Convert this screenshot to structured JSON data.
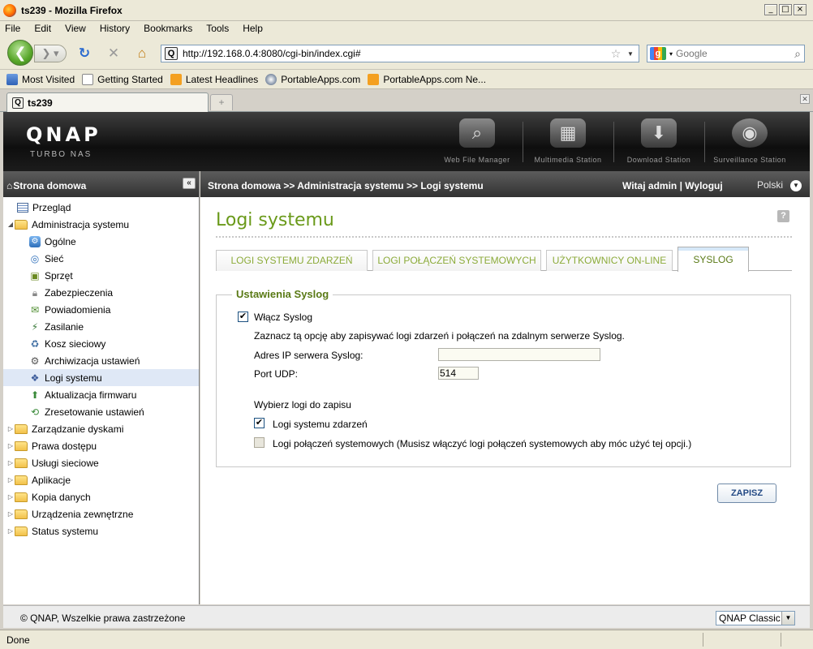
{
  "window": {
    "title": "ts239 - Mozilla Firefox",
    "controls": [
      "_",
      "□",
      "×"
    ]
  },
  "menu": [
    "File",
    "Edit",
    "View",
    "History",
    "Bookmarks",
    "Tools",
    "Help"
  ],
  "nav": {
    "url": "http://192.168.0.4:8080/cgi-bin/index.cgi#",
    "search_placeholder": "Google"
  },
  "bookmarks": [
    "Most Visited",
    "Getting Started",
    "Latest Headlines",
    "PortableApps.com",
    "PortableApps.com Ne..."
  ],
  "browser_tab": {
    "label": "ts239"
  },
  "qnap": {
    "logo": "QNAP",
    "subtitle": "Turbo NAS",
    "stations": [
      "Web File Manager",
      "Multimedia Station",
      "Download Station",
      "Surveillance Station"
    ]
  },
  "sidebar": {
    "header": "Strona domowa",
    "items": [
      {
        "label": "Przegląd"
      },
      {
        "label": "Administracja systemu"
      },
      {
        "label": "Ogólne"
      },
      {
        "label": "Sieć"
      },
      {
        "label": "Sprzęt"
      },
      {
        "label": "Zabezpieczenia"
      },
      {
        "label": "Powiadomienia"
      },
      {
        "label": "Zasilanie"
      },
      {
        "label": "Kosz sieciowy"
      },
      {
        "label": "Archiwizacja ustawień"
      },
      {
        "label": "Logi systemu"
      },
      {
        "label": "Aktualizacja firmwaru"
      },
      {
        "label": "Zresetowanie ustawień"
      },
      {
        "label": "Zarządzanie dyskami"
      },
      {
        "label": "Prawa dostępu"
      },
      {
        "label": "Usługi sieciowe"
      },
      {
        "label": "Aplikacje"
      },
      {
        "label": "Kopia danych"
      },
      {
        "label": "Urządzenia zewnętrzne"
      },
      {
        "label": "Status systemu"
      }
    ]
  },
  "header": {
    "breadcrumb": "Strona domowa >> Administracja systemu >> Logi systemu",
    "welcome": "Witaj admin",
    "separator": "|",
    "logout": "Wyloguj",
    "language": "Polski"
  },
  "page": {
    "title": "Logi systemu",
    "tabs": [
      "LOGI SYSTEMU ZDARZEŃ",
      "LOGI POŁĄCZEŃ SYSTEMOWYCH",
      "UŻYTKOWNICY ON-LINE",
      "SYSLOG"
    ],
    "active_tab": "SYSLOG"
  },
  "syslog": {
    "legend": "Ustawienia Syslog",
    "enable_label": "Włącz Syslog",
    "enable_checked": true,
    "description": "Zaznacz tą opcję aby zapisywać logi zdarzeń i połączeń na zdalnym serwerze Syslog.",
    "ip_label": "Adres IP serwera Syslog:",
    "ip_value": "",
    "port_label": "Port UDP:",
    "port_value": "514",
    "logs_heading": "Wybierz logi do zapisu",
    "event_logs_label": "Logi systemu zdarzeń",
    "event_logs_checked": true,
    "conn_logs_label": "Logi połączeń systemowych (Musisz włączyć logi połączeń systemowych aby móc użyć tej opcji.)",
    "conn_logs_checked": false
  },
  "save_label": "ZAPISZ",
  "footer": {
    "copyright": "© QNAP, Wszelkie prawa zastrzeżone",
    "theme": "QNAP Classic"
  },
  "status": "Done",
  "colors": {
    "accent": "#6a9a1a",
    "header_bg": "#323232",
    "selected_row": "#dfe8f6"
  }
}
